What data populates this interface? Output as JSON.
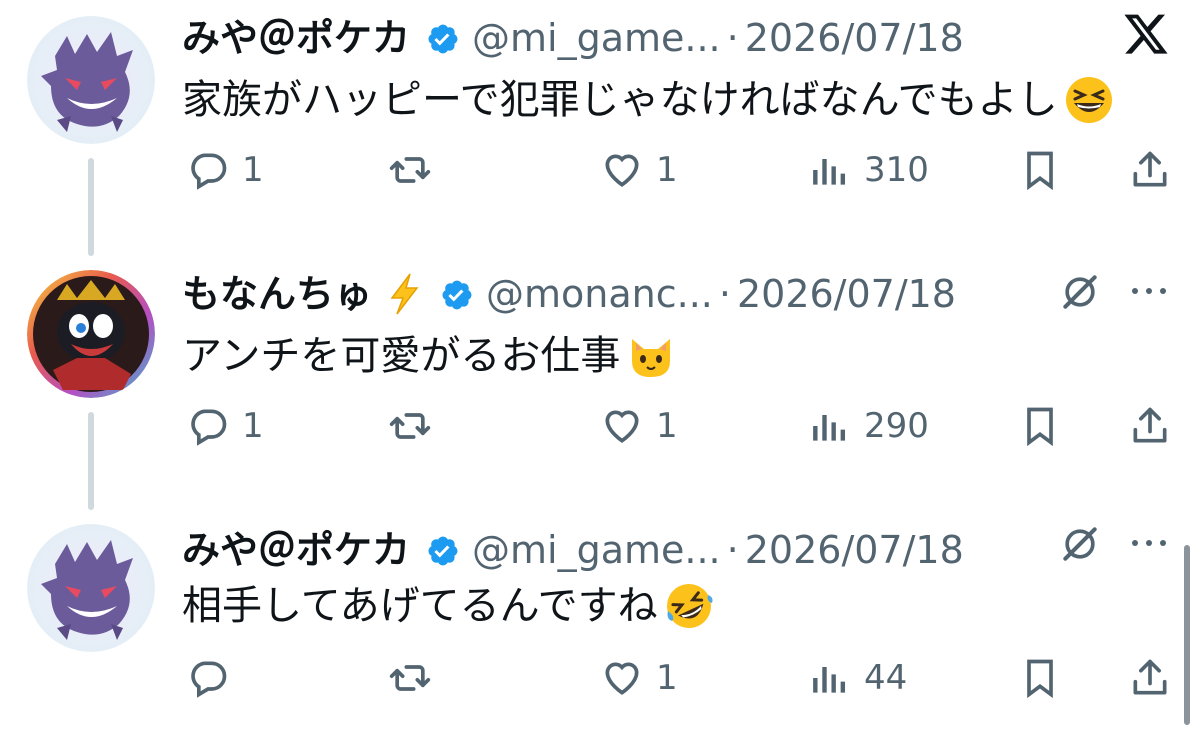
{
  "tweets": [
    {
      "name": "みや＠ポケカ",
      "handle": "@mi_game...",
      "dot": "·",
      "date": "2026/07/18",
      "text": "家族がハッピーで犯罪じゃなければなんでもよし",
      "text_emoji": "grinning-squinting-face",
      "reply_count": "1",
      "retweet_count": "",
      "like_count": "1",
      "views": "310",
      "avatar": "gengar-avatar"
    },
    {
      "name": "もなんちゅ",
      "name_emoji": "high-voltage",
      "handle": "@monanc...",
      "dot": "·",
      "date": "2026/07/18",
      "text": "アンチを可愛がるお仕事",
      "text_emoji": "cat-face",
      "reply_count": "1",
      "retweet_count": "",
      "like_count": "1",
      "views": "290",
      "avatar": "morgana-avatar"
    },
    {
      "name": "みや＠ポケカ",
      "handle": "@mi_game...",
      "dot": "·",
      "date": "2026/07/18",
      "text": "相手してあげてるんですね",
      "text_emoji": "rolling-on-floor-laughing",
      "reply_count": "",
      "retweet_count": "",
      "like_count": "1",
      "views": "44",
      "avatar": "gengar-avatar"
    }
  ],
  "colors": {
    "verified": "#1d9bf0",
    "muted": "#536471",
    "text": "#0f1419",
    "thread_line": "#cfd9de"
  }
}
